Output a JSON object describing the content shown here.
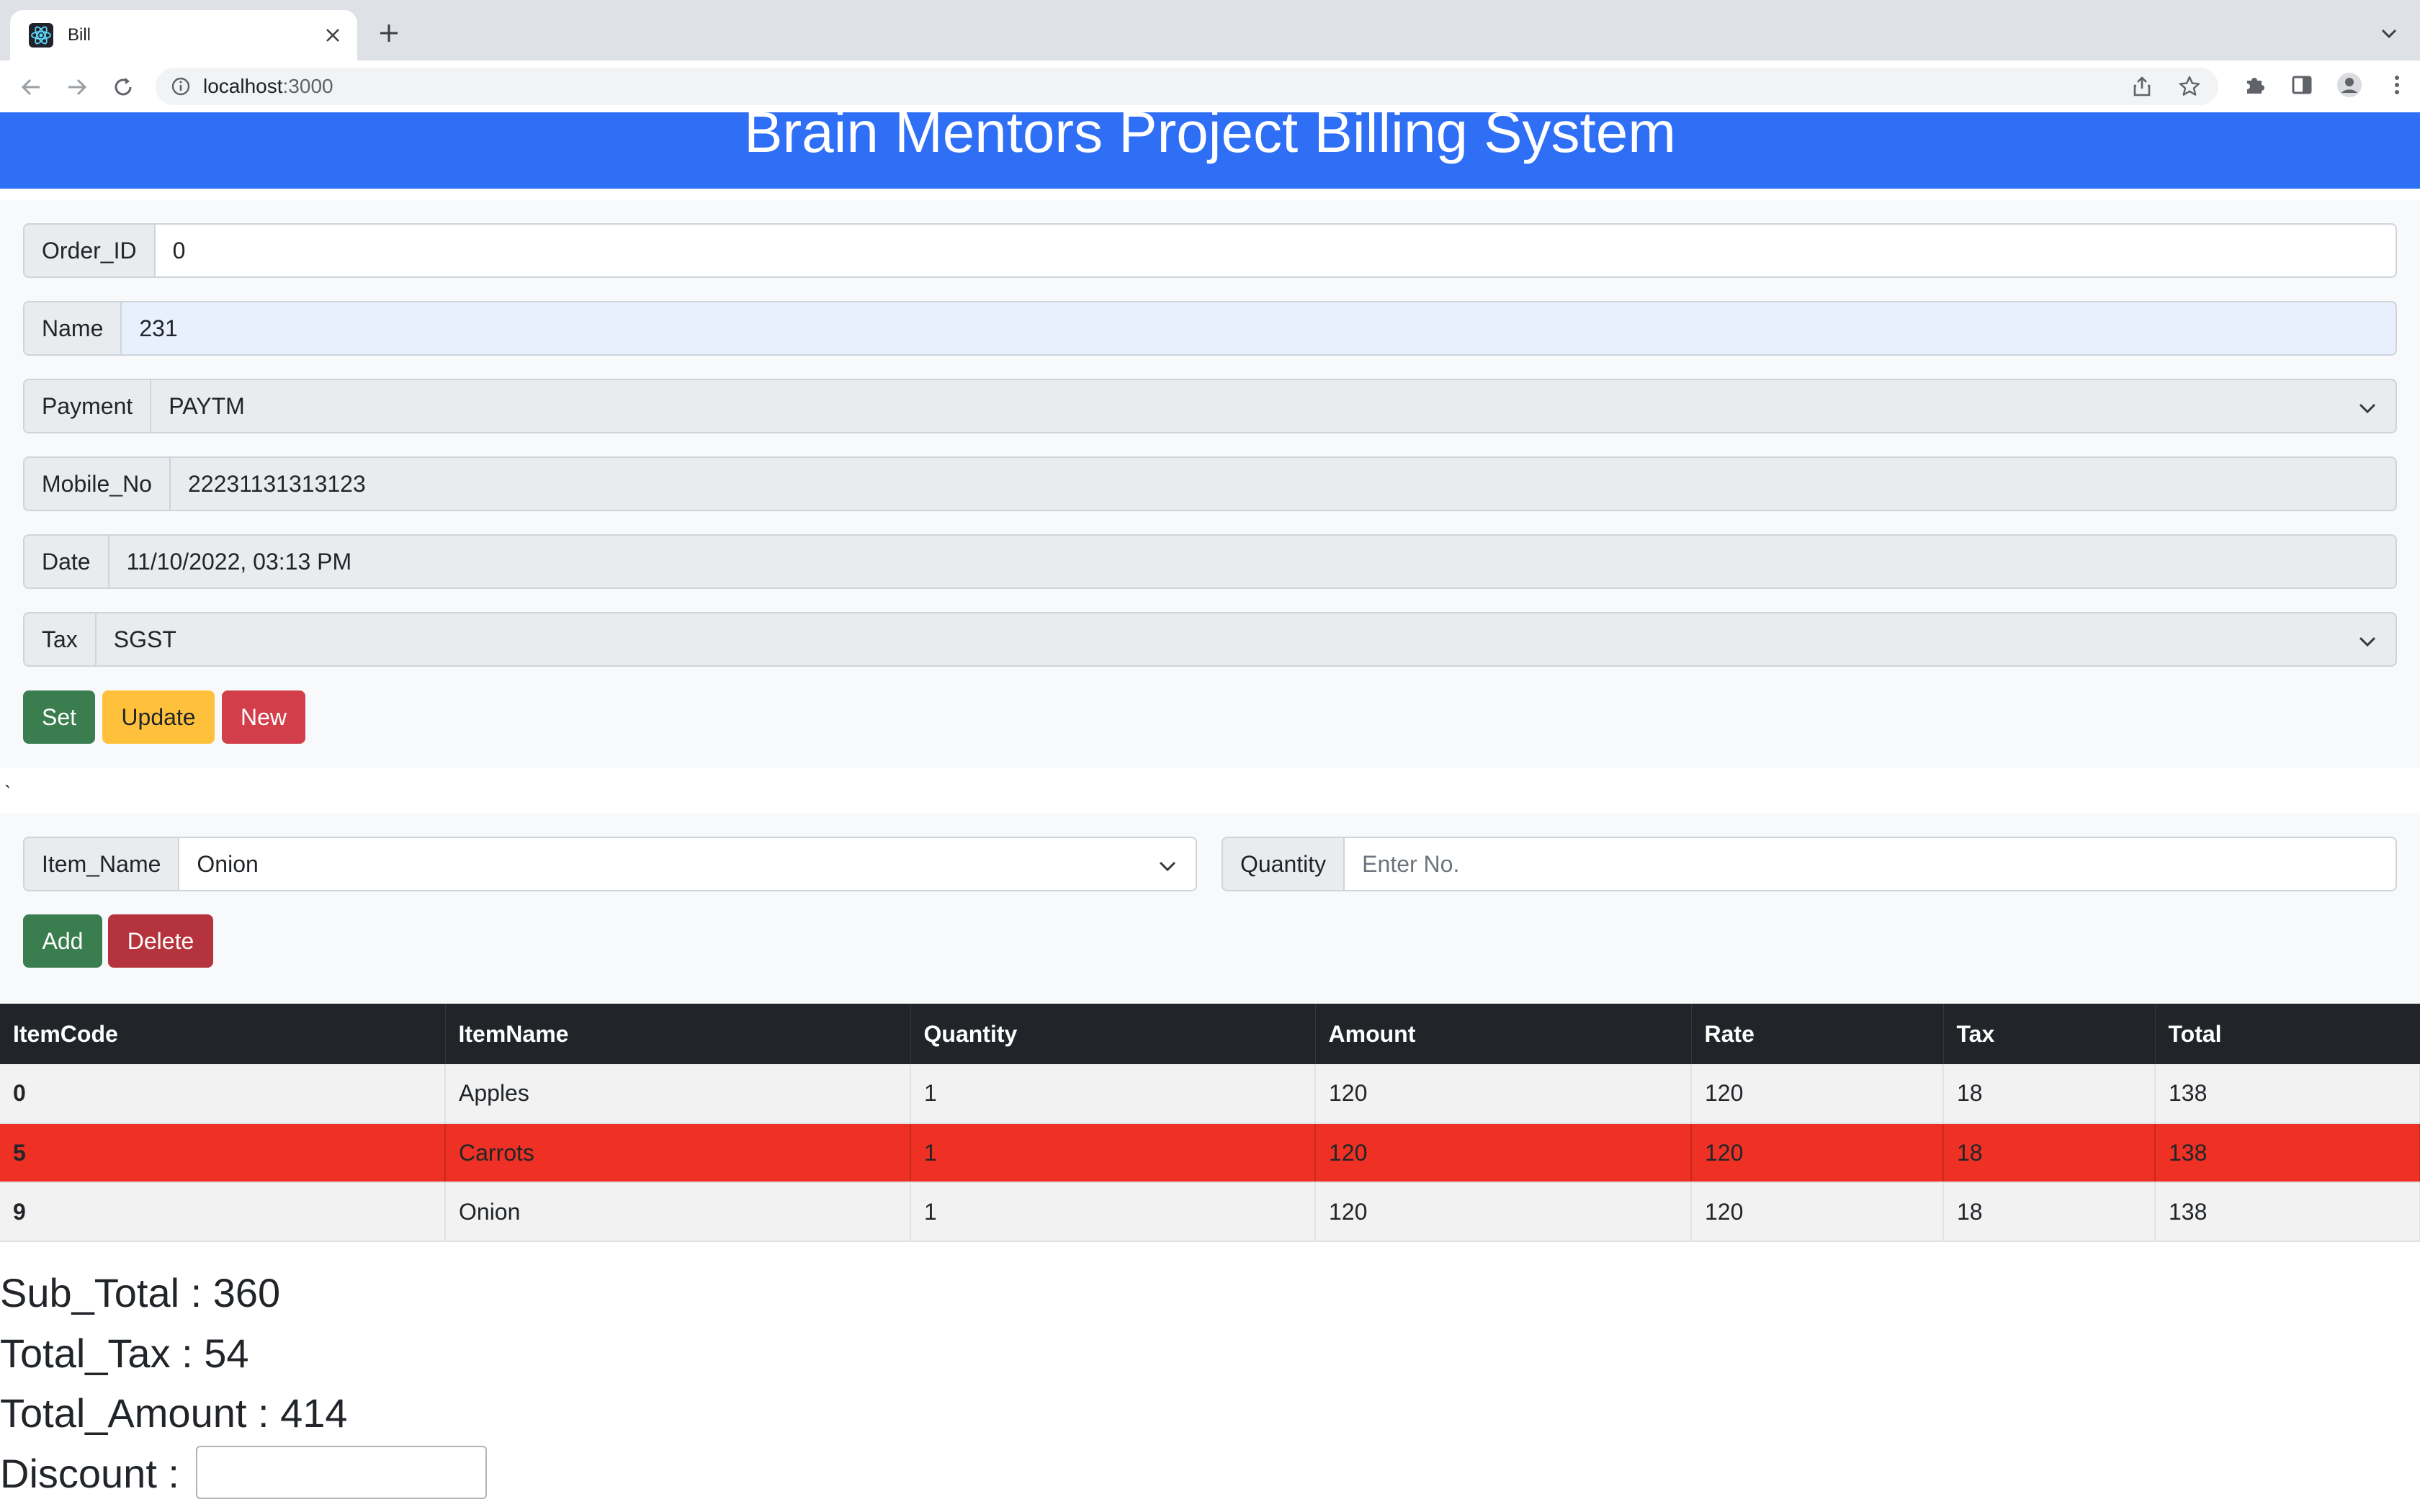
{
  "browser": {
    "tab_title": "Bill",
    "url_host": "localhost",
    "url_port": ":3000"
  },
  "banner": {
    "title": "Brain Mentors Project Billing System"
  },
  "order_form": {
    "order_id": {
      "label": "Order_ID",
      "value": "0"
    },
    "name": {
      "label": "Name",
      "value": "231"
    },
    "payment": {
      "label": "Payment",
      "value": "PAYTM"
    },
    "mobile": {
      "label": "Mobile_No",
      "value": "22231131313123"
    },
    "date": {
      "label": "Date",
      "value": "11/10/2022, 03:13 PM"
    },
    "tax": {
      "label": "Tax",
      "value": "SGST"
    },
    "buttons": {
      "set": "Set",
      "update": "Update",
      "new": "New"
    }
  },
  "stray_char": "`",
  "item_form": {
    "item_name": {
      "label": "Item_Name",
      "value": "Onion"
    },
    "quantity": {
      "label": "Quantity",
      "placeholder": "Enter No."
    },
    "buttons": {
      "add": "Add",
      "delete": "Delete"
    }
  },
  "table": {
    "headers": [
      "ItemCode",
      "ItemName",
      "Quantity",
      "Amount",
      "Rate",
      "Tax",
      "Total"
    ],
    "rows": [
      [
        "0",
        "Apples",
        "1",
        "120",
        "120",
        "18",
        "138"
      ],
      [
        "5",
        "Carrots",
        "1",
        "120",
        "120",
        "18",
        "138"
      ],
      [
        "9",
        "Onion",
        "1",
        "120",
        "120",
        "18",
        "138"
      ]
    ],
    "highlight_color": "#ee3124"
  },
  "summary": {
    "sub_total": {
      "label": "Sub_Total : ",
      "value": "360"
    },
    "total_tax": {
      "label": "Total_Tax : ",
      "value": "54"
    },
    "total_amount": {
      "label": "Total_Amount : ",
      "value": "414"
    },
    "discount": {
      "label": "Discount : ",
      "value": ""
    }
  },
  "colors": {
    "banner": "#2f6ff5",
    "btn_green": "#3a7d4f",
    "btn_yellow": "#ffc13b",
    "btn_red": "#d23f4b",
    "table_header": "#212529"
  }
}
